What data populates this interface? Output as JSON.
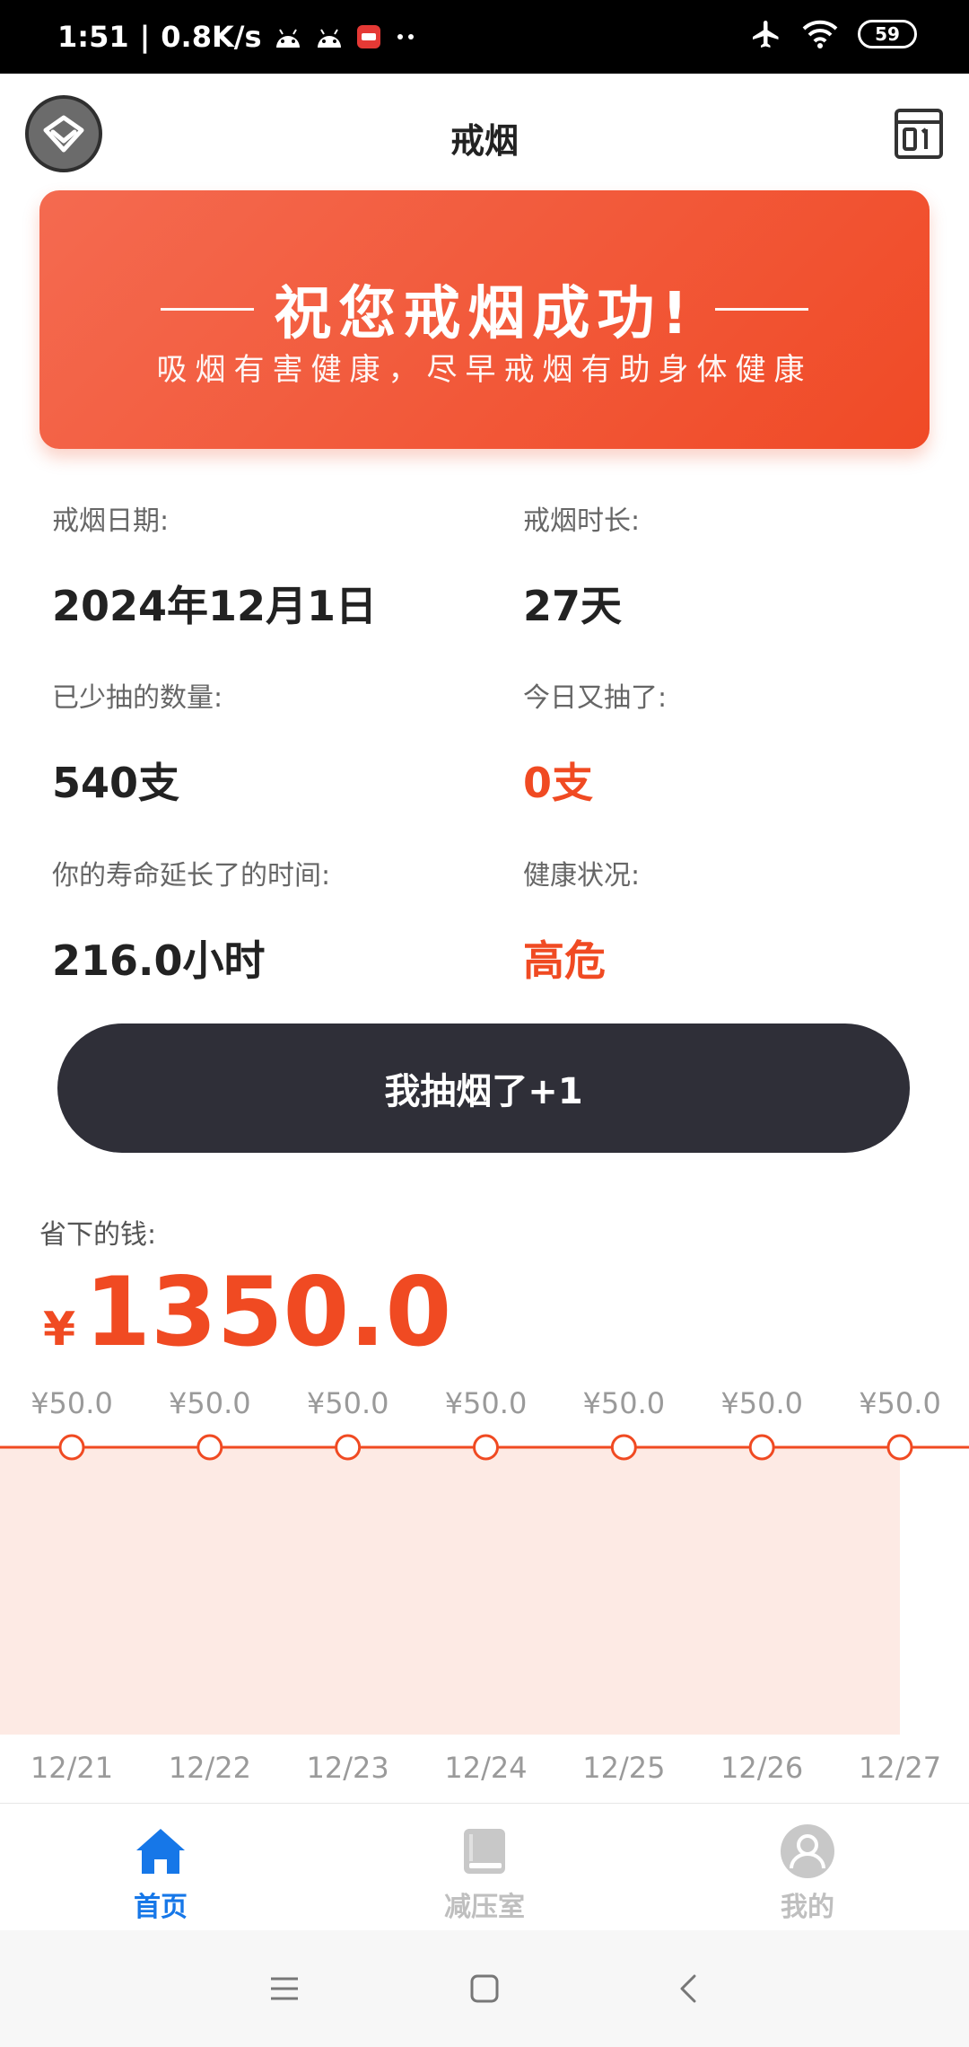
{
  "status_bar": {
    "time": "1:51",
    "speed": "0.8K/s",
    "battery": "59"
  },
  "header": {
    "title": "戒烟"
  },
  "banner": {
    "title": "祝您戒烟成功!",
    "subtitle": "吸烟有害健康，尽早戒烟有助身体健康"
  },
  "stats": {
    "quit_date_label": "戒烟日期:",
    "quit_date_value": "2024年12月1日",
    "duration_label": "戒烟时长:",
    "duration_value": "27天",
    "reduced_label": "已少抽的数量:",
    "reduced_value": "540支",
    "today_label": "今日又抽了:",
    "today_value": "0支",
    "life_label": "你的寿命延长了的时间:",
    "life_value": "216.0小时",
    "health_label": "健康状况:",
    "health_value": "高危"
  },
  "action": {
    "smoke_button": "我抽烟了+1"
  },
  "money": {
    "label": "省下的钱:",
    "currency": "¥",
    "value": "1350.0"
  },
  "chart_data": {
    "type": "area",
    "x": [
      "12/21",
      "12/22",
      "12/23",
      "12/24",
      "12/25",
      "12/26",
      "12/27"
    ],
    "values": [
      50.0,
      50.0,
      50.0,
      50.0,
      50.0,
      50.0,
      50.0
    ],
    "data_labels": [
      "¥50.0",
      "¥50.0",
      "¥50.0",
      "¥50.0",
      "¥50.0",
      "¥50.0",
      "¥50.0"
    ],
    "colors": {
      "line": "#f04a22",
      "fill": "#fdeae4"
    }
  },
  "nav": {
    "home": "首页",
    "relax": "减压室",
    "mine": "我的"
  },
  "colors": {
    "accent": "#f04a22",
    "nav_active": "#1677e8"
  }
}
